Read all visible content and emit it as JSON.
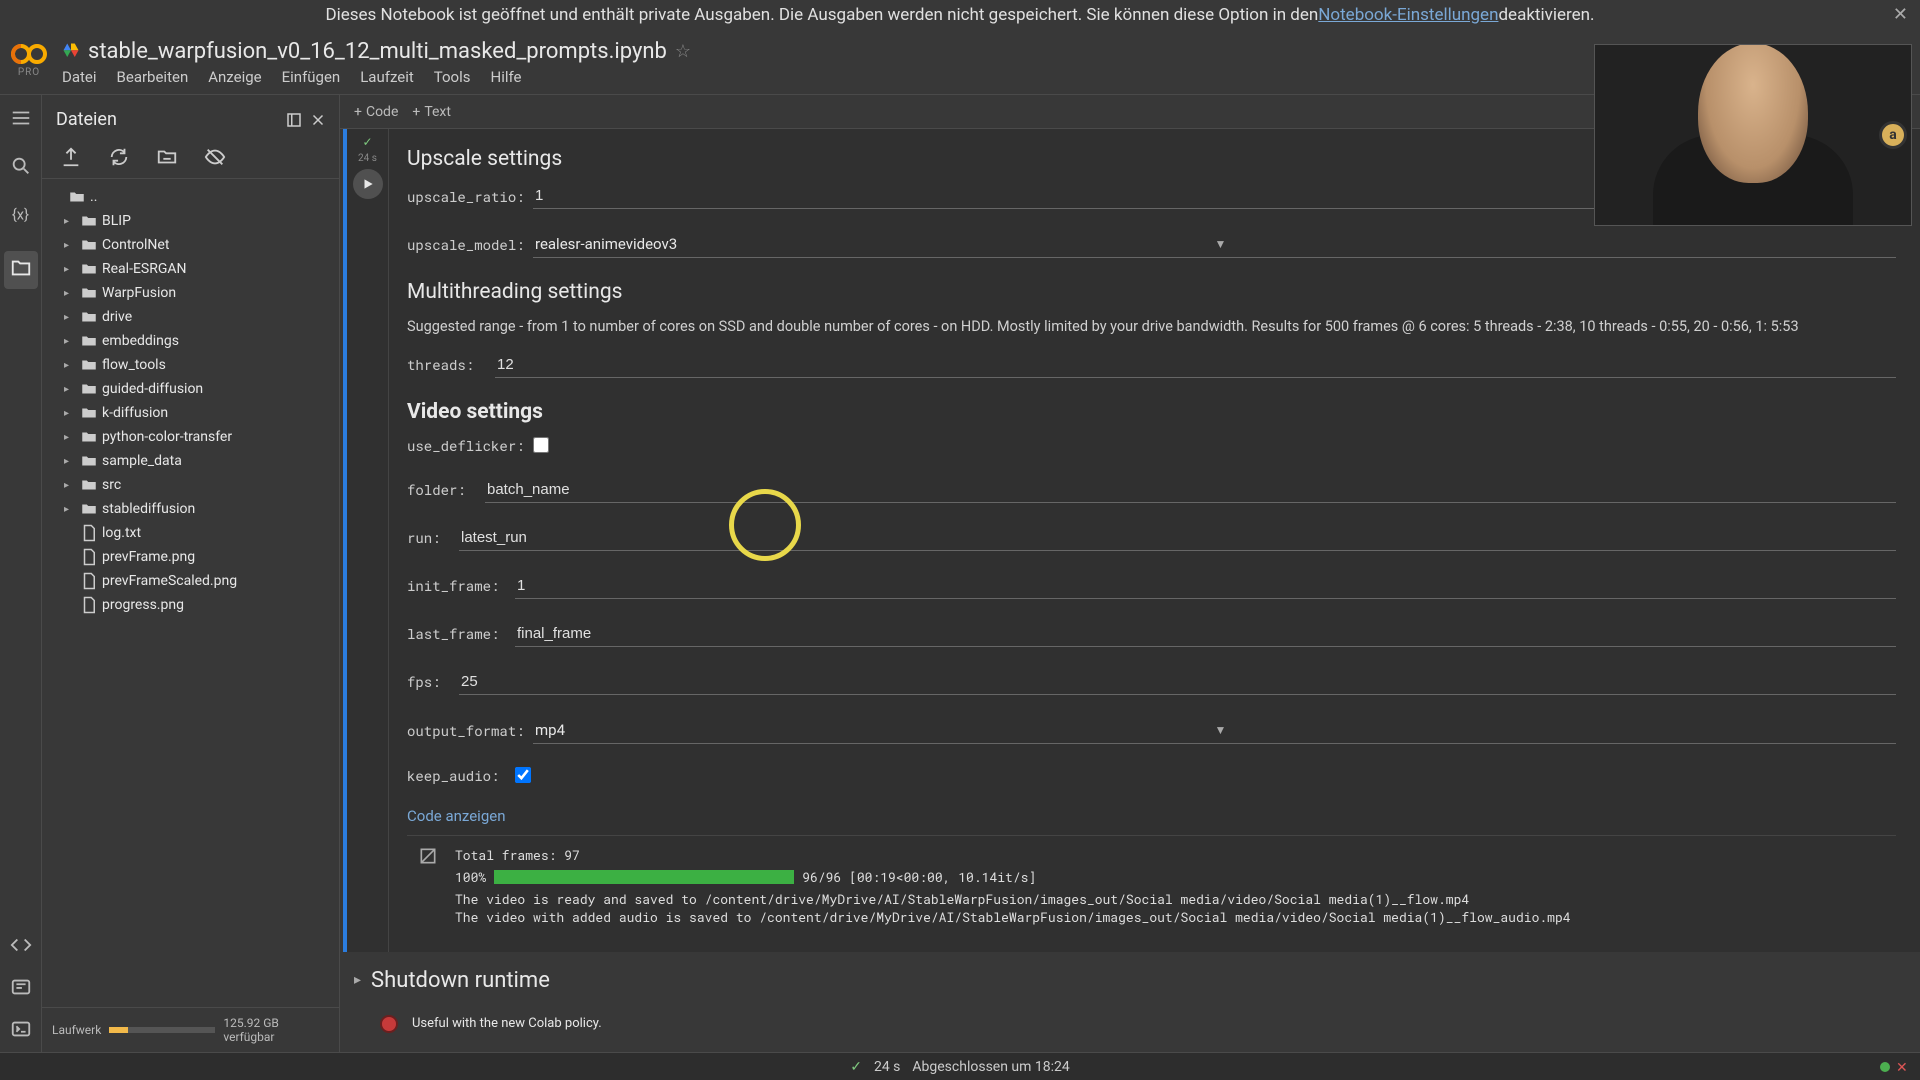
{
  "banner": {
    "text_before": "Dieses Notebook ist geöffnet und enthält private Ausgaben. Die Ausgaben werden nicht gespeichert. Sie können diese Option in den ",
    "link": "Notebook-Einstellungen",
    "text_after": " deaktivieren."
  },
  "header": {
    "pro": "PRO",
    "title": "stable_warpfusion_v0_16_12_multi_masked_prompts.ipynb",
    "menu": [
      "Datei",
      "Bearbeiten",
      "Anzeige",
      "Einfügen",
      "Laufzeit",
      "Tools",
      "Hilfe"
    ],
    "avatar_letter": "a"
  },
  "sidebar": {
    "title": "Dateien",
    "parent": "..",
    "folders": [
      "BLIP",
      "ControlNet",
      "Real-ESRGAN",
      "WarpFusion",
      "drive",
      "embeddings",
      "flow_tools",
      "guided-diffusion",
      "k-diffusion",
      "python-color-transfer",
      "sample_data",
      "src",
      "stablediffusion"
    ],
    "files": [
      "log.txt",
      "prevFrame.png",
      "prevFrameScaled.png",
      "progress.png"
    ],
    "disk_label": "Laufwerk",
    "disk_free": "125.92 GB verfügbar"
  },
  "insert": {
    "code": "Code",
    "text": "Text"
  },
  "gutter": {
    "time": "24 s"
  },
  "form": {
    "upscale_title": "Upscale settings",
    "upscale_ratio_label": "upscale_ratio:",
    "upscale_ratio": "1",
    "upscale_model_label": "upscale_model:",
    "upscale_model": "realesr-animevideov3",
    "mt_title": "Multithreading settings",
    "mt_desc": "Suggested range - from 1 to number of cores on SSD and double number of cores - on HDD. Mostly limited by your drive bandwidth. Results for 500 frames @ 6 cores: 5 threads - 2:38, 10 threads - 0:55, 20 - 0:56, 1: 5:53",
    "threads_label": "threads:",
    "threads": "12",
    "video_title": "Video settings",
    "use_deflicker_label": "use_deflicker:",
    "folder_label": "folder:",
    "folder": "batch_name",
    "run_label": "run:",
    "run": "latest_run",
    "init_frame_label": "init_frame:",
    "init_frame": "1",
    "last_frame_label": "last_frame:",
    "last_frame": "final_frame",
    "fps_label": "fps:",
    "fps": "25",
    "output_format_label": "output_format:",
    "output_format": "mp4",
    "keep_audio_label": "keep_audio:",
    "show_code": "Code anzeigen"
  },
  "output": {
    "total_frames": "Total frames: 97",
    "pct": "100%",
    "prog_text": "96/96 [00:19<00:00, 10.14it/s]",
    "line1": "The video is ready and saved to /content/drive/MyDrive/AI/StableWarpFusion/images_out/Social media/video/Social media(1)__flow.mp4",
    "line2": "The video with added audio is saved to /content/drive/MyDrive/AI/StableWarpFusion/images_out/Social media/video/Social media(1)__flow_audio.mp4"
  },
  "shutdown": {
    "title": "Shutdown runtime",
    "useful": "Useful with the new Colab policy."
  },
  "status": {
    "time": "24 s",
    "done": "Abgeschlossen um 18:24"
  }
}
